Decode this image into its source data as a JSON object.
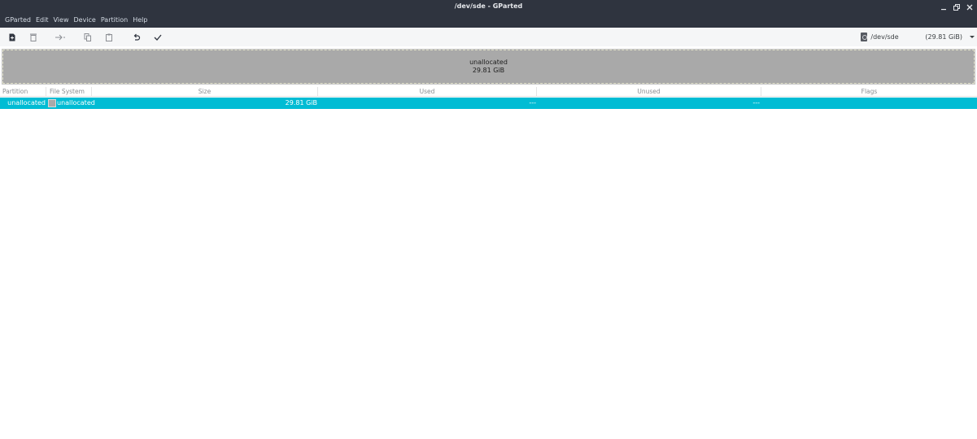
{
  "window": {
    "title": "/dev/sde - GParted"
  },
  "menubar": {
    "items": [
      "GParted",
      "Edit",
      "View",
      "Device",
      "Partition",
      "Help"
    ]
  },
  "toolbar": {
    "buttons": [
      "new-partition",
      "delete-partition",
      "resize-move-partition",
      "copy-partition",
      "paste-partition",
      "undo",
      "apply"
    ]
  },
  "device": {
    "name": "/dev/sde",
    "size": "(29.81 GiB)"
  },
  "partition_map": {
    "label": "unallocated",
    "size": "29.81 GiB",
    "color": "#a9a9a9"
  },
  "table": {
    "headers": [
      "Partition",
      "File System",
      "Size",
      "Used",
      "Unused",
      "Flags"
    ],
    "rows": [
      {
        "partition": "unallocated",
        "file_system": "unallocated",
        "size": "29.81 GiB",
        "used": "---",
        "unused": "---",
        "flags": ""
      }
    ]
  },
  "colors": {
    "titlebar": "#2f343f",
    "selection": "#00bcd4"
  }
}
